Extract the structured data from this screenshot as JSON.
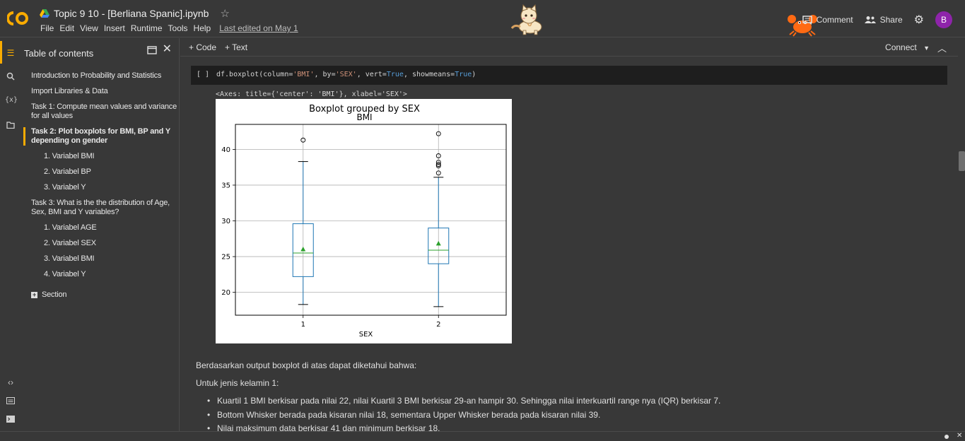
{
  "header": {
    "notebook_title": "Topic 9 10 - [Berliana Spanic].ipynb",
    "menu": [
      "File",
      "Edit",
      "View",
      "Insert",
      "Runtime",
      "Tools",
      "Help"
    ],
    "last_edited": "Last edited on May 1",
    "comment_label": "Comment",
    "share_label": "Share",
    "avatar_letter": "B",
    "avatar_color": "#8e24aa",
    "logo_color": "#f9ab00"
  },
  "toc": {
    "title": "Table of contents",
    "items": [
      {
        "label": "Introduction to Probability and Statistics"
      },
      {
        "label": "Import Libraries & Data"
      },
      {
        "label_line1": "Task 1: Compute mean values and variance",
        "label_line2": "for all values"
      },
      {
        "label_line1": "Task 2: Plot boxplots for BMI, BP and Y",
        "label_line2": "depending on gender"
      },
      {
        "label": "1. Variabel BMI"
      },
      {
        "label": "2. Variabel BP"
      },
      {
        "label": "3. Variabel Y"
      },
      {
        "label_line1": "Task 3: What is the the distribution of Age,",
        "label_line2": "Sex, BMI and Y variables?"
      },
      {
        "label": "1. Variabel AGE"
      },
      {
        "label": "2. Variabel SEX"
      },
      {
        "label": "3. Variabel BMI"
      },
      {
        "label": "4. Variabel Y"
      },
      {
        "label": "Section"
      }
    ]
  },
  "toolbar": {
    "add_code": "+ Code",
    "add_text": "+ Text",
    "connect": "Connect"
  },
  "cell": {
    "exec_count": "[ ]",
    "code_prefix": "df.boxplot(column=",
    "code_s1": "'BMI'",
    "code_m1": ", by=",
    "code_s2": "'SEX'",
    "code_m2": ", vert=",
    "code_k1": "True",
    "code_m3": ", showmeans=",
    "code_k2": "True",
    "code_suffix": ")",
    "output_repr": "<Axes: title={'center': 'BMI'}, xlabel='SEX'>"
  },
  "chart_data": {
    "type": "box",
    "suptitle": "Boxplot grouped by SEX",
    "title": "BMI",
    "xlabel": "SEX",
    "ylabel": "",
    "categories": [
      "1",
      "2"
    ],
    "ylim": [
      16.8,
      43.5
    ],
    "yticks": [
      20,
      25,
      30,
      35,
      40
    ],
    "grid": true,
    "boxes": [
      {
        "name": "1",
        "whislo": 18.3,
        "q1": 22.2,
        "med": 25.5,
        "q3": 29.6,
        "whishi": 38.3,
        "mean": 26.0,
        "fliers": [
          41.3
        ]
      },
      {
        "name": "2",
        "whislo": 18.0,
        "q1": 24.0,
        "med": 25.9,
        "q3": 29.0,
        "whishi": 36.1,
        "mean": 26.8,
        "fliers": [
          42.2,
          39.1,
          38.2,
          37.9,
          37.7,
          36.7
        ]
      }
    ],
    "colors": {
      "box": "#1f77b4",
      "median": "#2ca02c",
      "mean": "#2ca02c",
      "flier": "#000000"
    }
  },
  "text": {
    "p1": "Berdasarkan output boxplot di atas dapat diketahui bahwa:",
    "p2": "Untuk jenis kelamin 1:",
    "bullets": [
      "Kuartil 1 BMI berkisar pada nilai 22, nilai Kuartil 3 BMI berkisar 29-an hampir 30. Sehingga nilai interkuartil range nya (IQR) berkisar 7.",
      "Bottom Whisker berada pada kisaran nilai 18, sementara Upper Whisker berada pada kisaran nilai 39.",
      "Nilai maksimum data berkisar 41 dan minimum berkisar 18."
    ]
  }
}
